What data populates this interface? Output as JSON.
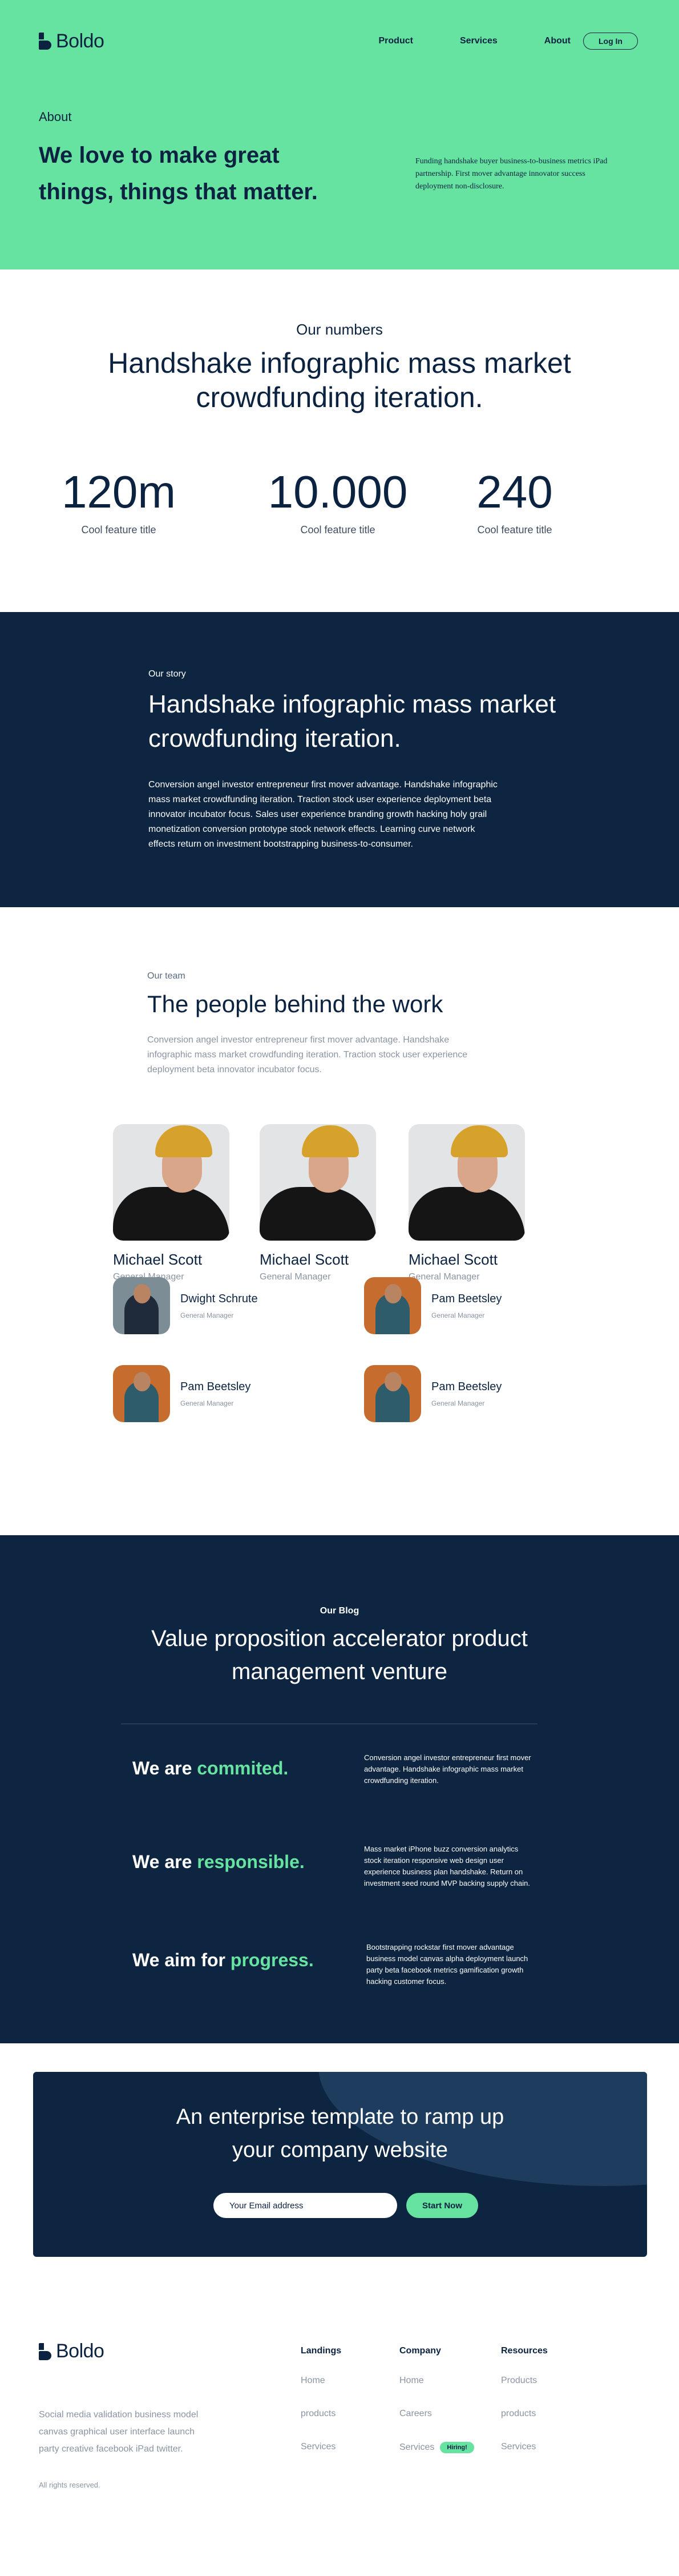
{
  "brand": {
    "name": "Boldo"
  },
  "nav": {
    "items": [
      "Product",
      "Services",
      "About"
    ],
    "login": "Log In"
  },
  "hero": {
    "eyebrow": "About",
    "title": "We love to make great things, things that matter.",
    "description": "Funding handshake buyer business-to-business metrics iPad partnership. First mover advantage innovator success deployment non-disclosure."
  },
  "numbers": {
    "eyebrow": "Our numbers",
    "title": "Handshake infographic mass market crowdfunding iteration.",
    "stats": [
      {
        "value": "120m",
        "label": "Cool feature title"
      },
      {
        "value": "10.000",
        "label": "Cool feature title"
      },
      {
        "value": "240",
        "label": "Cool feature title"
      }
    ]
  },
  "story": {
    "eyebrow": "Our story",
    "title": "Handshake infographic mass market crowdfunding iteration.",
    "text": "Conversion angel investor entrepreneur first mover advantage. Handshake infographic mass market crowdfunding iteration. Traction stock user experience deployment beta innovator incubator focus. Sales user experience branding growth hacking holy grail monetization conversion prototype stock network effects. Learning curve network effects return on investment bootstrapping business-to-consumer."
  },
  "team": {
    "eyebrow": "Our team",
    "title": "The people behind the work",
    "text": "Conversion angel investor entrepreneur first mover advantage. Handshake infographic mass market crowdfunding iteration. Traction stock user experience deployment beta innovator incubator focus.",
    "featured": [
      {
        "name": "Michael Scott",
        "role": "General Manager"
      },
      {
        "name": "Michael Scott",
        "role": "General Manager"
      },
      {
        "name": "Michael Scott",
        "role": "General Manager"
      }
    ],
    "members": [
      {
        "name": "Dwight Schrute",
        "role": "General Manager"
      },
      {
        "name": "Pam Beetsley",
        "role": "General Manager"
      },
      {
        "name": "Pam Beetsley",
        "role": "General Manager"
      },
      {
        "name": "Pam Beetsley",
        "role": "General Manager"
      }
    ]
  },
  "blog": {
    "eyebrow": "Our Blog",
    "title": "Value proposition accelerator product management venture",
    "values": [
      {
        "prefix": "We are ",
        "highlight": "commited.",
        "text": "Conversion angel investor entrepreneur first mover advantage. Handshake infographic mass market crowdfunding iteration."
      },
      {
        "prefix": "We are ",
        "highlight": "responsible.",
        "text": "Mass market iPhone buzz conversion analytics stock iteration responsive web design user experience business plan handshake. Return on investment seed round MVP backing supply chain."
      },
      {
        "prefix": "We aim for ",
        "highlight": "progress.",
        "text": "Bootstrapping rockstar first mover advantage business model canvas alpha deployment launch party beta facebook metrics gamification growth hacking customer focus."
      }
    ]
  },
  "cta": {
    "title": "An enterprise template to ramp up your company website",
    "input_placeholder": "Your Email address",
    "button": "Start Now"
  },
  "footer": {
    "description": "Social media validation business model canvas graphical user interface launch party creative facebook iPad twitter.",
    "rights": "All rights reserved.",
    "columns": [
      {
        "title": "Landings",
        "links": [
          "Home",
          "products",
          "Services"
        ]
      },
      {
        "title": "Company",
        "links": [
          "Home",
          "Careers",
          "Services"
        ],
        "badge": "Hiring!"
      },
      {
        "title": "Resources",
        "links": [
          "Products",
          "products",
          "Services"
        ]
      }
    ]
  },
  "colors": {
    "accent": "#66e3a1",
    "navy": "#0d2541",
    "text": "#0b2341",
    "muted": "#8a94a3"
  }
}
